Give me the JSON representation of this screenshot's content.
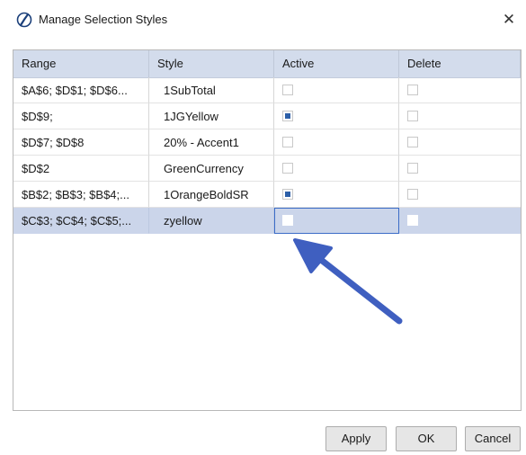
{
  "window": {
    "title": "Manage Selection Styles",
    "close_label": "✕"
  },
  "grid": {
    "columns": [
      "Range",
      "Style",
      "Active",
      "Delete"
    ],
    "rows": [
      {
        "range": "$A$6; $D$1; $D$6...",
        "style": "1SubTotal",
        "active": false,
        "delete": false
      },
      {
        "range": "$D$9;",
        "style": "1JGYellow",
        "active": true,
        "delete": false
      },
      {
        "range": "$D$7; $D$8",
        "style": "20% - Accent1",
        "active": false,
        "delete": false
      },
      {
        "range": "$D$2",
        "style": "GreenCurrency",
        "active": false,
        "delete": false
      },
      {
        "range": "$B$2; $B$3; $B$4;...",
        "style": "1OrangeBoldSR",
        "active": true,
        "delete": false
      },
      {
        "range": "$C$3; $C$4; $C$5;...",
        "style": "zyellow",
        "active": false,
        "delete": false,
        "selected": true
      }
    ]
  },
  "buttons": {
    "apply": "Apply",
    "ok": "OK",
    "cancel": "Cancel"
  },
  "colors": {
    "header_bg": "#d3dcec",
    "selected_row_bg": "#cbd5ea",
    "checkbox_fill": "#2d5fa8",
    "annotation_arrow": "#3f5fc0"
  }
}
